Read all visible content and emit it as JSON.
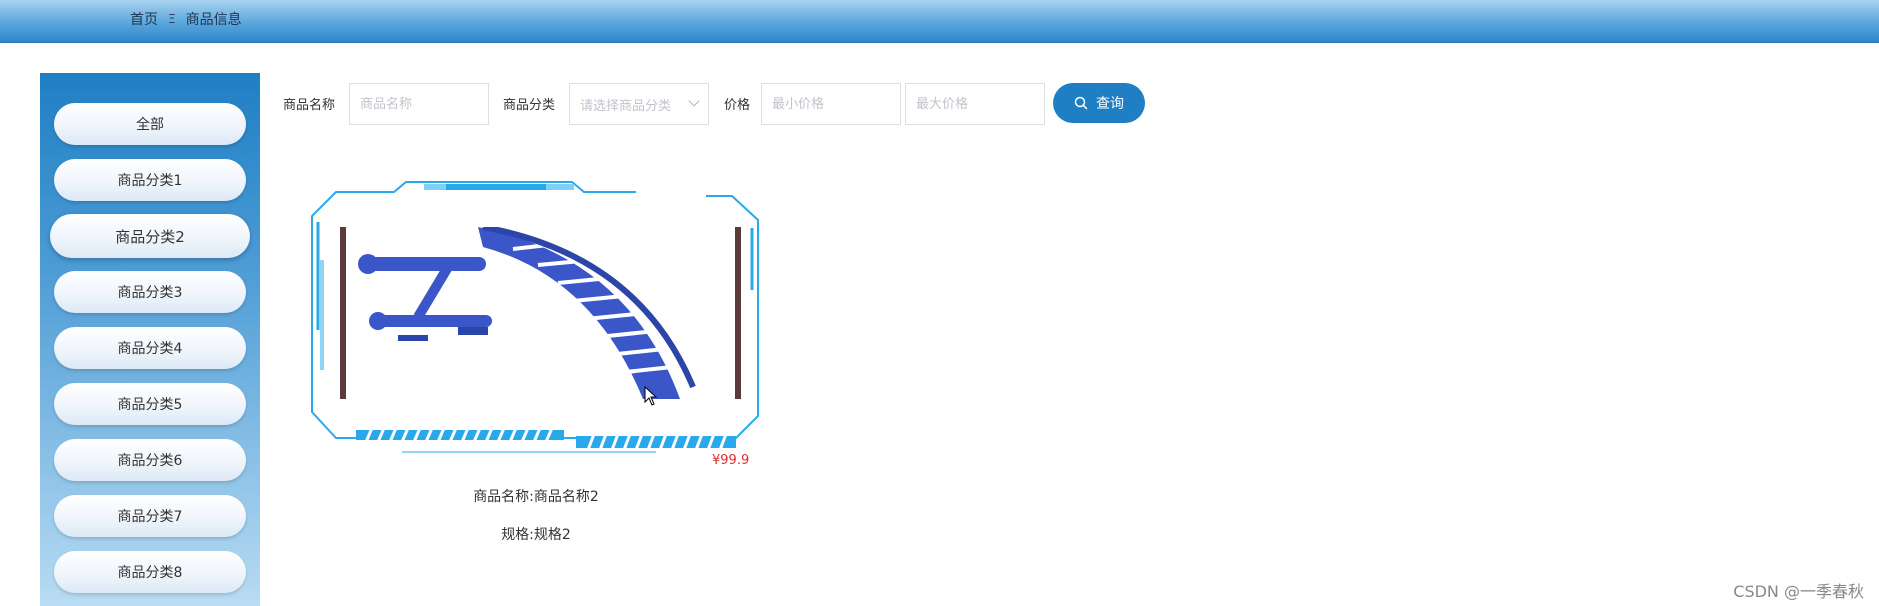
{
  "breadcrumb": {
    "home": "首页",
    "separator": "Ξ",
    "current": "商品信息"
  },
  "sidebar": {
    "categories": [
      {
        "label": "全部"
      },
      {
        "label": "商品分类1"
      },
      {
        "label": "商品分类2",
        "active": true
      },
      {
        "label": "商品分类3"
      },
      {
        "label": "商品分类4"
      },
      {
        "label": "商品分类5"
      },
      {
        "label": "商品分类6"
      },
      {
        "label": "商品分类7"
      },
      {
        "label": "商品分类8"
      }
    ]
  },
  "filters": {
    "name_label": "商品名称",
    "name_placeholder": "商品名称",
    "category_label": "商品分类",
    "category_placeholder": "请选择商品分类",
    "price_label": "价格",
    "min_price_placeholder": "最小价格",
    "max_price_placeholder": "最大价格",
    "search_label": "查询",
    "search_icon": "search-icon"
  },
  "product": {
    "price": "¥99.9",
    "name": "商品名称:商品名称2",
    "spec": "规格:规格2",
    "image": "blue-fitness-equipment"
  },
  "colors": {
    "primary": "#1f7fc4",
    "price": "#e02b2b",
    "frame": "#2aa8ec"
  },
  "watermark": "CSDN @一季春秋"
}
